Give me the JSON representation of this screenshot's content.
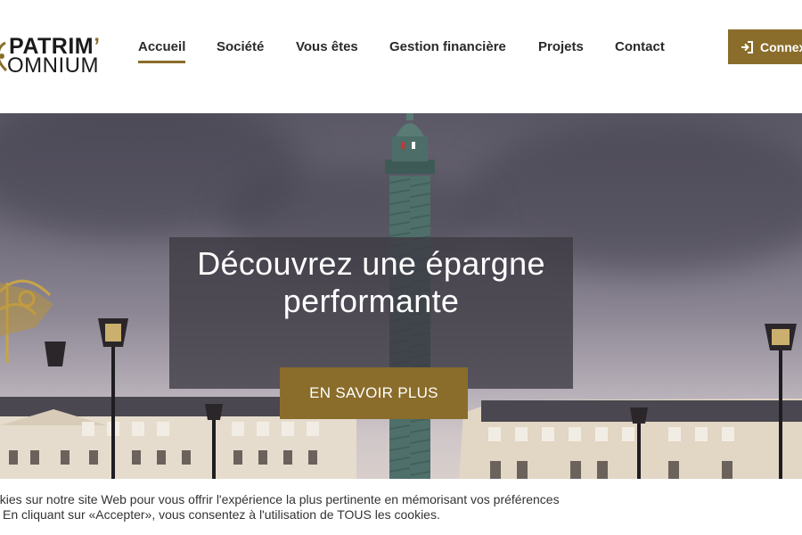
{
  "brand": {
    "line1": "PATRIM",
    "apostrophe": "’",
    "line2": "OMNIUM",
    "accent_color": "#8a6d2b"
  },
  "nav": {
    "items": [
      {
        "label": "Accueil",
        "active": true
      },
      {
        "label": "Société",
        "active": false
      },
      {
        "label": "Vous êtes",
        "active": false
      },
      {
        "label": "Gestion financière",
        "active": false
      },
      {
        "label": "Projets",
        "active": false
      },
      {
        "label": "Contact",
        "active": false
      }
    ]
  },
  "header": {
    "login_label": "Connex",
    "login_icon": "sign-in-icon"
  },
  "hero": {
    "title": "Découvrez une épargne performante",
    "cta_label": "EN SAVOIR PLUS"
  },
  "cookie_banner": {
    "line1": "okies sur notre site Web pour vous offrir l'expérience la plus pertinente en mémorisant vos préférences",
    "line2": "En cliquant sur «Accepter», vous consentez à l'utilisation de TOUS les cookies."
  }
}
